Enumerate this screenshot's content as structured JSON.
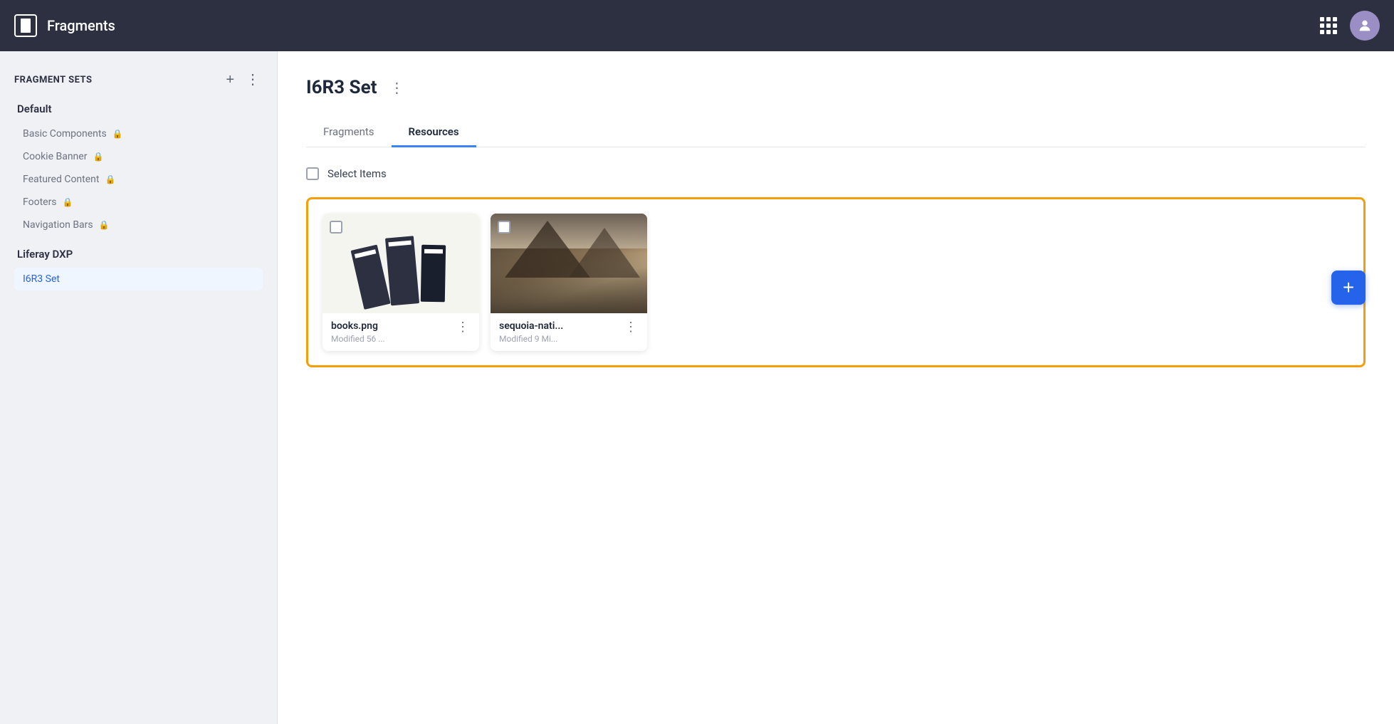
{
  "nav": {
    "title": "Fragments",
    "logo_label": "logo",
    "grid_icon_label": "apps-grid",
    "avatar_label": "user-avatar",
    "avatar_char": "👤"
  },
  "sidebar": {
    "header": "FRAGMENT SETS",
    "add_btn_label": "+",
    "menu_btn_label": "⋮",
    "groups": [
      {
        "label": "Default",
        "items": [
          {
            "name": "Basic Components",
            "locked": true
          },
          {
            "name": "Cookie Banner",
            "locked": true
          },
          {
            "name": "Featured Content",
            "locked": true
          },
          {
            "name": "Footers",
            "locked": true
          },
          {
            "name": "Navigation Bars",
            "locked": true
          }
        ]
      },
      {
        "label": "Liferay DXP",
        "items": [
          {
            "name": "I6R3 Set",
            "locked": false,
            "active": true
          }
        ]
      }
    ]
  },
  "main": {
    "page_title": "I6R3 Set",
    "page_menu_label": "⋮",
    "tabs": [
      {
        "label": "Fragments",
        "active": false
      },
      {
        "label": "Resources",
        "active": true
      }
    ],
    "select_items_label": "Select Items",
    "resources": [
      {
        "name": "books.png",
        "meta": "Modified 56 ...",
        "type": "books"
      },
      {
        "name": "sequoia-nati...",
        "meta": "Modified 9 Mi...",
        "type": "mountain"
      }
    ],
    "add_btn_label": "+"
  }
}
